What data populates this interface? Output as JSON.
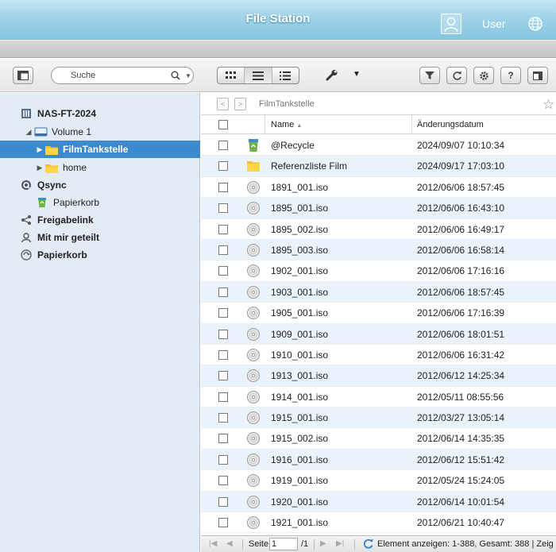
{
  "app": {
    "title": "File Station",
    "user": "User"
  },
  "toolbar": {
    "search_placeholder": "Suche"
  },
  "sidebar": {
    "items": [
      {
        "label": "NAS-FT-2024",
        "icon": "nas-icon"
      },
      {
        "label": "Volume 1",
        "icon": "drive-icon"
      },
      {
        "label": "FilmTankstelle",
        "icon": "folder-icon",
        "selected": true
      },
      {
        "label": "home",
        "icon": "folder-icon"
      },
      {
        "label": "Qsync",
        "icon": "qsync-icon"
      },
      {
        "label": "Papierkorb",
        "icon": "recycle-icon"
      },
      {
        "label": "Freigabelink",
        "icon": "share-icon"
      },
      {
        "label": "Mit mir geteilt",
        "icon": "shared-with-me-icon"
      },
      {
        "label": "Papierkorb",
        "icon": "recycle-bin-icon"
      }
    ]
  },
  "path": {
    "current": "FilmTankstelle"
  },
  "table": {
    "columns": {
      "name": "Name",
      "date": "Änderungsdatum"
    },
    "rows": [
      {
        "name": "@Recycle",
        "date": "2024/09/07 10:10:34",
        "type": "recycle"
      },
      {
        "name": "Referenzliste Film",
        "date": "2024/09/17 17:03:10",
        "type": "folder"
      },
      {
        "name": "1891_001.iso",
        "date": "2012/06/06 18:57:45",
        "type": "iso"
      },
      {
        "name": "1895_001.iso",
        "date": "2012/06/06 16:43:10",
        "type": "iso"
      },
      {
        "name": "1895_002.iso",
        "date": "2012/06/06 16:49:17",
        "type": "iso"
      },
      {
        "name": "1895_003.iso",
        "date": "2012/06/06 16:58:14",
        "type": "iso"
      },
      {
        "name": "1902_001.iso",
        "date": "2012/06/06 17:16:16",
        "type": "iso"
      },
      {
        "name": "1903_001.iso",
        "date": "2012/06/06 18:57:45",
        "type": "iso"
      },
      {
        "name": "1905_001.iso",
        "date": "2012/06/06 17:16:39",
        "type": "iso"
      },
      {
        "name": "1909_001.iso",
        "date": "2012/06/06 18:01:51",
        "type": "iso"
      },
      {
        "name": "1910_001.iso",
        "date": "2012/06/06 16:31:42",
        "type": "iso"
      },
      {
        "name": "1913_001.iso",
        "date": "2012/06/12 14:25:34",
        "type": "iso"
      },
      {
        "name": "1914_001.iso",
        "date": "2012/05/11 08:55:56",
        "type": "iso"
      },
      {
        "name": "1915_001.iso",
        "date": "2012/03/27 13:05:14",
        "type": "iso"
      },
      {
        "name": "1915_002.iso",
        "date": "2012/06/14 14:35:35",
        "type": "iso"
      },
      {
        "name": "1916_001.iso",
        "date": "2012/06/12 15:51:42",
        "type": "iso"
      },
      {
        "name": "1919_001.iso",
        "date": "2012/05/24 15:24:05",
        "type": "iso"
      },
      {
        "name": "1920_001.iso",
        "date": "2012/06/14 10:01:54",
        "type": "iso"
      },
      {
        "name": "1921_001.iso",
        "date": "2012/06/21 10:40:47",
        "type": "iso"
      }
    ]
  },
  "status": {
    "page_label": "Seite",
    "page_value": "1",
    "page_total": "/1",
    "summary": "Element anzeigen: 1-388, Gesamt: 388 | Zeig"
  },
  "colors": {
    "titlebar": "#9fd3e8",
    "sidebar": "#e3ecf6",
    "selected": "#3d89ce",
    "row_alt": "#eaf2fb"
  }
}
